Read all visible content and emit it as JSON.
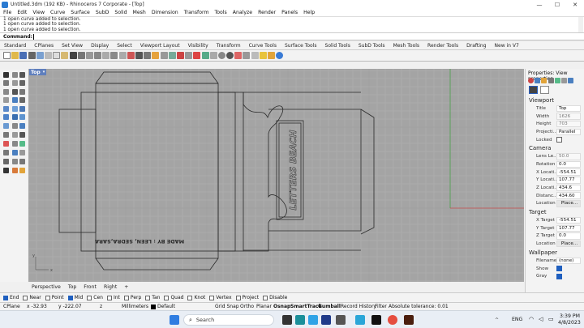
{
  "window": {
    "title": "Untitled.3dm (192 KB) - Rhinoceros 7 Corporate - [Top]",
    "minimize": "—",
    "maximize": "☐",
    "close": "✕"
  },
  "menu": [
    "File",
    "Edit",
    "View",
    "Curve",
    "Surface",
    "SubD",
    "Solid",
    "Mesh",
    "Dimension",
    "Transform",
    "Tools",
    "Analyze",
    "Render",
    "Panels",
    "Help"
  ],
  "history": [
    "1 open curve added to selection.",
    "1 open curve added to selection.",
    "1 open curve added to selection."
  ],
  "command": {
    "label": "Command:"
  },
  "toolbar_tabs": [
    "Standard",
    "CPlanes",
    "Set View",
    "Display",
    "Select",
    "Viewport Layout",
    "Visibility",
    "Transform",
    "Curve Tools",
    "Surface Tools",
    "Solid Tools",
    "SubD Tools",
    "Mesh Tools",
    "Render Tools",
    "Drafting",
    "New in V7"
  ],
  "viewport": {
    "name": "Top",
    "drawing_text_1": "LETTERS BEACH",
    "drawing_text_2": "MADE BY : LEEN, SEDRA,SARA",
    "axis_x": "x",
    "axis_y": "y",
    "colors": {
      "background": "#a4a4a4",
      "grid": "#b2b2b2",
      "grid_major": "#9a9a9a",
      "x_axis": "#c44a4a",
      "y_axis": "#4aa34a"
    }
  },
  "view_tabs": [
    "Perspective",
    "Top",
    "Front",
    "Right",
    "+"
  ],
  "osnaps": [
    {
      "label": "End",
      "on": true
    },
    {
      "label": "Near",
      "on": false
    },
    {
      "label": "Point",
      "on": false
    },
    {
      "label": "Mid",
      "on": true
    },
    {
      "label": "Cen",
      "on": false
    },
    {
      "label": "Int",
      "on": false
    },
    {
      "label": "Perp",
      "on": false
    },
    {
      "label": "Tan",
      "on": false
    },
    {
      "label": "Quad",
      "on": false
    },
    {
      "label": "Knot",
      "on": false
    },
    {
      "label": "Vertex",
      "on": false
    },
    {
      "label": "Project",
      "on": false
    },
    {
      "label": "Disable",
      "on": false
    }
  ],
  "status": {
    "cplane": "CPlane",
    "x": "x -32.93",
    "y": "y -222.07",
    "z": "z",
    "units": "Millimeters",
    "layer": "Default",
    "toggles": [
      "Grid Snap",
      "Ortho",
      "Planar",
      "Osnap",
      "SmartTrack",
      "Gumball",
      "Record History",
      "Filter"
    ],
    "tolerance": "Absolute tolerance: 0.01"
  },
  "properties": {
    "header": "Properties: View properties",
    "viewport_section": "Viewport",
    "viewport_rows": [
      {
        "k": "Title",
        "v": "Top"
      },
      {
        "k": "Width",
        "v": "1626"
      },
      {
        "k": "Height",
        "v": "703"
      },
      {
        "k": "Projecti...",
        "v": "Parallel"
      },
      {
        "k": "Locked",
        "v": ""
      }
    ],
    "camera_section": "Camera",
    "camera_rows": [
      {
        "k": "Lens Le...",
        "v": "50.0"
      },
      {
        "k": "Rotation",
        "v": "0.0"
      },
      {
        "k": "X Locati...",
        "v": "-554.51"
      },
      {
        "k": "Y Locati...",
        "v": "107.77"
      },
      {
        "k": "Z Locati...",
        "v": "434.6"
      },
      {
        "k": "Distanc...",
        "v": "434.60"
      },
      {
        "k": "Location",
        "v": "Place..."
      }
    ],
    "target_section": "Target",
    "target_rows": [
      {
        "k": "X Target",
        "v": "-554.51"
      },
      {
        "k": "Y Target",
        "v": "107.77"
      },
      {
        "k": "Z Target",
        "v": "0.0"
      },
      {
        "k": "Location",
        "v": "Place..."
      }
    ],
    "wallpaper_section": "Wallpaper",
    "wallpaper_rows": [
      {
        "k": "Filename",
        "v": "(none)"
      },
      {
        "k": "Show",
        "v": ""
      },
      {
        "k": "Gray",
        "v": ""
      }
    ]
  },
  "taskbar": {
    "search": "Search",
    "lang": "ENG",
    "time": "3:39 PM",
    "date": "4/8/2023"
  }
}
